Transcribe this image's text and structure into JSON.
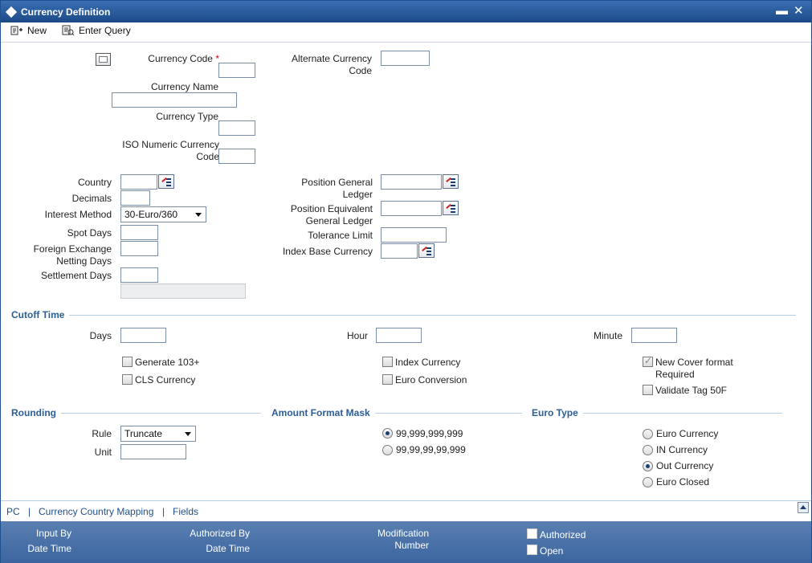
{
  "window": {
    "title": "Currency Definition",
    "minimize": "▬",
    "close": "✕"
  },
  "toolbar": {
    "new_label": "New",
    "enter_query_label": "Enter Query"
  },
  "form": {
    "currency_code_label": "Currency Code",
    "required_mark": "*",
    "alternate_currency_code_label_1": "Alternate Currency",
    "alternate_currency_code_label_2": "Code",
    "currency_name_label": "Currency Name",
    "currency_type_label": "Currency Type",
    "iso_numeric_label_1": "ISO Numeric Currency",
    "iso_numeric_label_2": "Code",
    "country_label": "Country",
    "decimals_label": "Decimals",
    "interest_method_label": "Interest Method",
    "interest_method_value": "30-Euro/360",
    "spot_days_label": "Spot Days",
    "fx_netting_label_1": "Foreign Exchange",
    "fx_netting_label_2": "Netting Days",
    "settlement_days_label": "Settlement Days",
    "position_gl_label_1": "Position General",
    "position_gl_label_2": "Ledger",
    "position_eq_gl_label_1": "Position Equivalent",
    "position_eq_gl_label_2": "General Ledger",
    "tolerance_limit_label": "Tolerance Limit",
    "index_base_currency_label": "Index Base Currency"
  },
  "cutoff": {
    "section_title": "Cutoff Time",
    "days_label": "Days",
    "hour_label": "Hour",
    "minute_label": "Minute",
    "generate_103_label": "Generate 103+",
    "cls_currency_label": "CLS Currency",
    "index_currency_label": "Index Currency",
    "euro_conversion_label": "Euro Conversion",
    "new_cover_label_1": "New Cover format",
    "new_cover_label_2": "Required",
    "validate_tag_label": "Validate Tag 50F"
  },
  "rounding": {
    "section_title": "Rounding",
    "rule_label": "Rule",
    "rule_value": "Truncate",
    "unit_label": "Unit"
  },
  "amount_format": {
    "section_title": "Amount Format Mask",
    "option_1": "99,999,999,999",
    "option_2": "99,99,99,99,999"
  },
  "euro_type": {
    "section_title": "Euro Type",
    "option_1": "Euro Currency",
    "option_2": "IN Currency",
    "option_3": "Out Currency",
    "option_4": "Euro Closed"
  },
  "footer_links": {
    "pc": "PC",
    "sep": "|",
    "mapping": "Currency Country Mapping",
    "fields": "Fields"
  },
  "audit": {
    "input_by": "Input By",
    "date_time": "Date Time",
    "authorized_by": "Authorized By",
    "modification": "Modification",
    "number": "Number",
    "authorized": "Authorized",
    "open": "Open"
  }
}
